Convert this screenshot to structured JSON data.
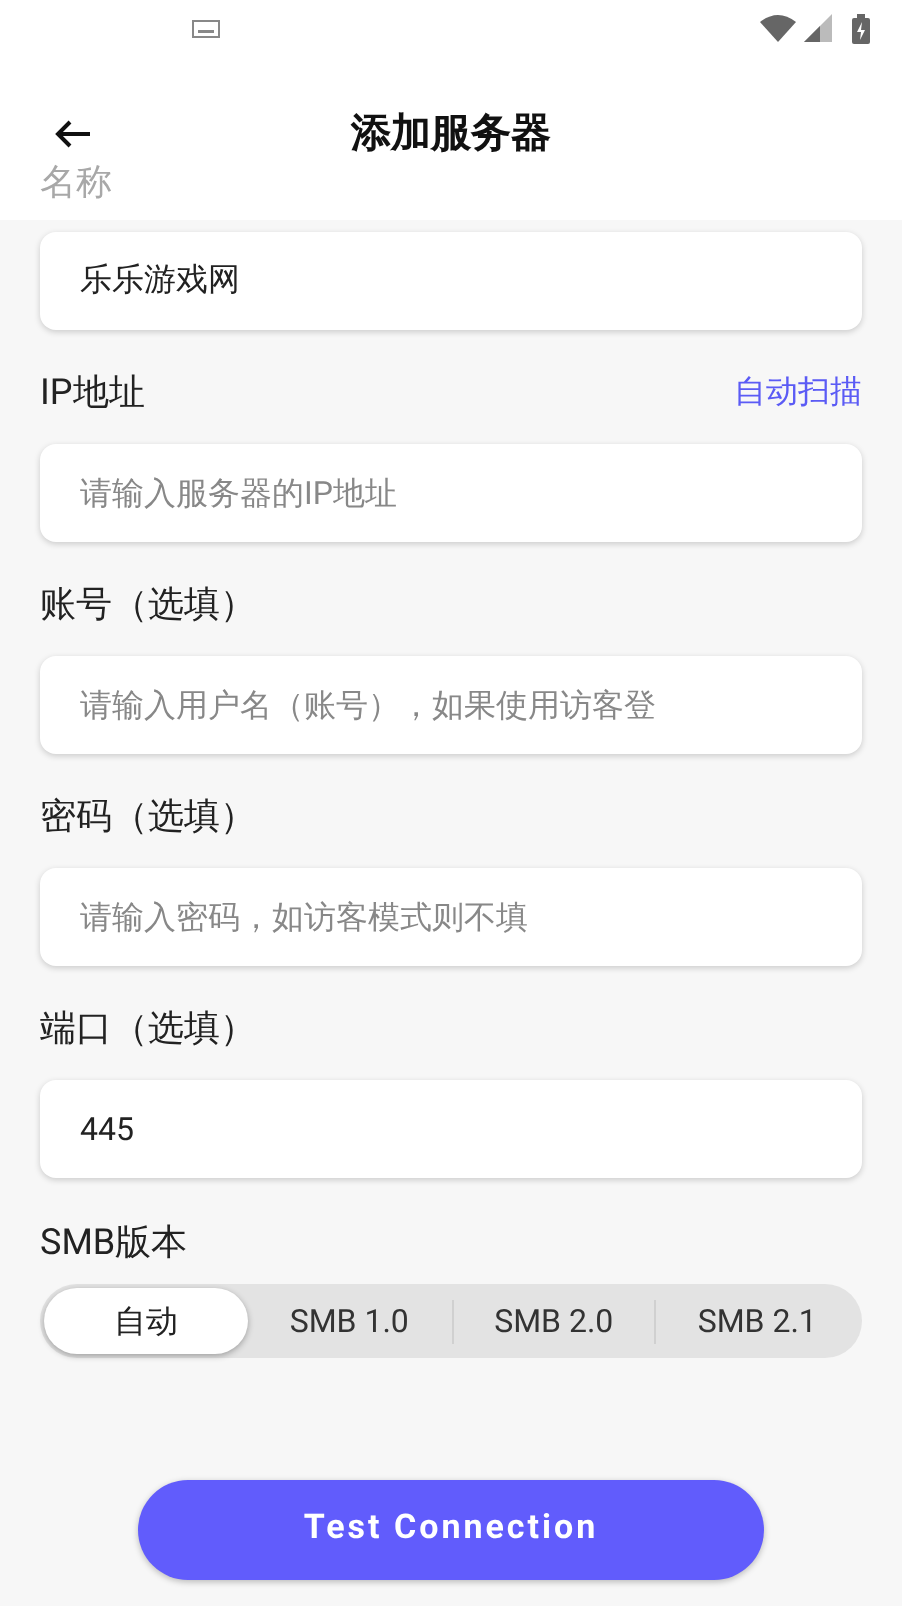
{
  "header": {
    "title": "添加服务器"
  },
  "fields": [
    {
      "label": "名称",
      "label_faded": true,
      "value": "乐乐游戏网"
    },
    {
      "label": "IP地址",
      "label_faded": false,
      "action": "自动扫描",
      "placeholder": "请输入服务器的IP地址"
    },
    {
      "label": "账号（选填）",
      "label_faded": false,
      "placeholder": "请输入用户名（账号），如果使用访客登"
    },
    {
      "label": "密码（选填）",
      "label_faded": false,
      "placeholder": "请输入密码，如访客模式则不填"
    },
    {
      "label": "端口（选填）",
      "label_faded": false,
      "value": "445"
    }
  ],
  "smb_version": {
    "label": "SMB版本",
    "options": [
      {
        "label": "自动",
        "selected": true
      },
      {
        "label": "SMB 1.0",
        "selected": false
      },
      {
        "label": "SMB 2.0",
        "selected": false
      },
      {
        "label": "SMB 2.1",
        "selected": false
      }
    ]
  },
  "button": "Test Connection"
}
